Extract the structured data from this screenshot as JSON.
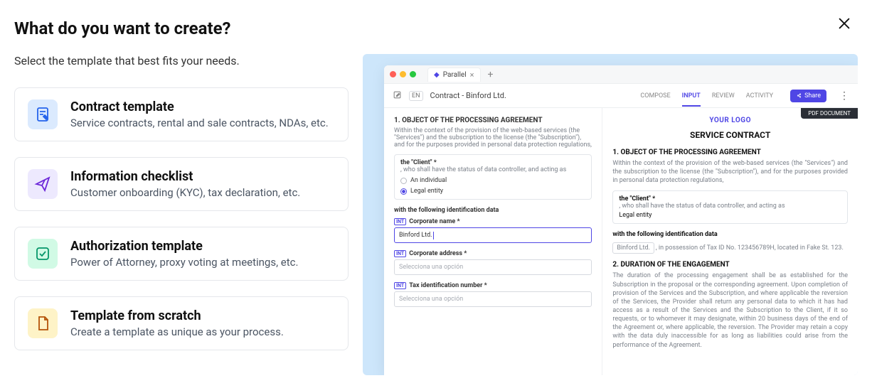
{
  "header": {
    "title": "What do you want to create?",
    "subtitle": "Select the template that best fits your needs."
  },
  "close_label": "Close",
  "templates": [
    {
      "title": "Contract template",
      "desc": "Service contracts, rental and sale contracts, NDAs, etc."
    },
    {
      "title": "Information checklist",
      "desc": "Customer onboarding (KYC), tax declaration, etc."
    },
    {
      "title": "Authorization template",
      "desc": "Power of Attorney, proxy voting at meetings, etc."
    },
    {
      "title": "Template from scratch",
      "desc": "Create a template as unique as your process."
    }
  ],
  "preview": {
    "tab_name": "Parallel",
    "lang": "EN",
    "doc_title": "Contract - Binford Ltd.",
    "nav": [
      "COMPOSE",
      "INPUT",
      "REVIEW",
      "ACTIVITY"
    ],
    "share_label": "Share",
    "pdf_badge": "PDF DOCUMENT",
    "form": {
      "section1_h": "1. OBJECT OF THE PROCESSING AGREEMENT",
      "section1_p": "Within the context of the provision of the web-based services (the \"Services\") and the subscription to the license (the \"Subscription\"), and for the purposes provided in personal data protection regulations,",
      "client_label": "the \"Client\" *",
      "client_sub": ", who shall have the status of data controller, and acting as",
      "opt_individual": "An individual",
      "opt_legal": "Legal entity",
      "ident_h": "with the following identification data",
      "int_tag": "INT",
      "f1_label": "Corporate name *",
      "f1_value": "Binford Ltd.",
      "f2_label": "Corporate address *",
      "f2_placeholder": "Selecciona una opción",
      "f3_label": "Tax identification number *",
      "f3_placeholder": "Selecciona una opción"
    },
    "doc": {
      "logo": "YOUR LOGO",
      "title": "SERVICE CONTRACT",
      "s1_h": "1. OBJECT OF THE PROCESSING AGREEMENT",
      "s1_p": "Within the context of the provision of the web-based services (the \"Services\") and the subscription to the license (the \"Subscription\"), and for the purposes provided in personal data protection regulations,",
      "client_label": "the \"Client\" *",
      "client_sub": ", who shall have the status of data controller, and acting as",
      "client_val": "Legal entity",
      "ident_h": "with the following identification data",
      "chip": "Binford Ltd.",
      "ident_tail": ", in possession of Tax ID No. 123456789H, located in Fake St. 123.",
      "s2_h": "2. DURATION OF THE ENGAGEMENT",
      "s2_p": "The duration of the processing engagement shall be as established for the Subscription in the proposal or the corresponding agreement. Upon completion of provision of the Services and the Subscription, and where applicable the reversion of the Services, the Provider shall return any personal data to which it has had access as a result of the Services and the Subscription to the Client, if it so requests, or to whomever it may designate, within 20 business days of the end of the Agreement or, where applicable, the reversion. The Provider may retain a copy with the data duly inaccessible for as long as liabilities could arise from the performance of the Agreement."
    }
  }
}
